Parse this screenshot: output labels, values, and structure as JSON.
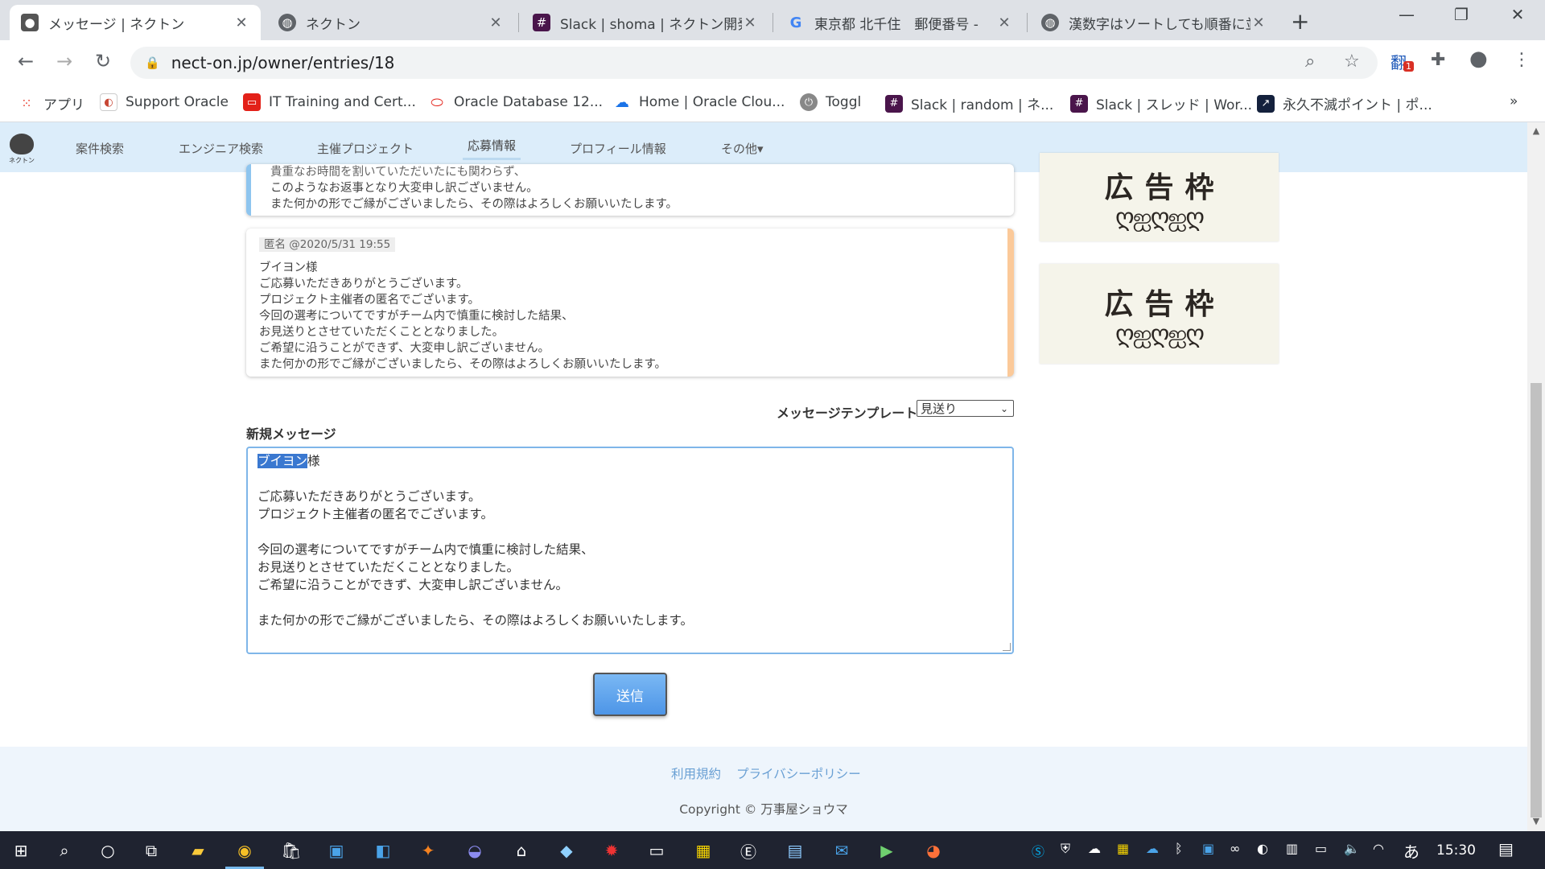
{
  "browser": {
    "tabs": [
      {
        "title": "メッセージ | ネクトン",
        "active": true
      },
      {
        "title": "ネクトン"
      },
      {
        "title": "Slack | shoma | ネクトン開発"
      },
      {
        "title": "東京都 北千住　郵便番号 -"
      },
      {
        "title": "漢数字はソートしても順番に並"
      }
    ],
    "url": "nect-on.jp/owner/entries/18",
    "extension_badge": "1",
    "bookmarks": [
      {
        "label": "アプリ"
      },
      {
        "label": "Support Oracle"
      },
      {
        "label": "IT Training and Cert..."
      },
      {
        "label": "Oracle Database 12..."
      },
      {
        "label": "Home | Oracle Clou..."
      },
      {
        "label": "Toggl"
      },
      {
        "label": "Slack | random | ネ..."
      },
      {
        "label": "Slack | スレッド | Wor..."
      },
      {
        "label": "永久不滅ポイント | ポ..."
      }
    ],
    "more_bookmarks": "»"
  },
  "site": {
    "logo_text": "ネクトン",
    "nav": [
      {
        "label": "案件検索"
      },
      {
        "label": "エンジニア検索"
      },
      {
        "label": "主催プロジェクト"
      },
      {
        "label": "応募情報",
        "active": true
      },
      {
        "label": "プロフィール情報"
      },
      {
        "label": "その他▾"
      }
    ]
  },
  "messages": {
    "own_partial_lines": [
      "貴重なお時間を割いていただいたにも関わらず、",
      "このようなお返事となり大変申し訳ございません。",
      "また何かの形でご縁がございましたら、その際はよろしくお願いいたします。"
    ],
    "other": {
      "meta": "匿名 @2020/5/31 19:55",
      "lines": [
        "ブイヨン様",
        "ご応募いただきありがとうございます。",
        "プロジェクト主催者の匿名でございます。",
        "今回の選考についてですがチーム内で慎重に検討した結果、",
        "お見送りとさせていただくこととなりました。",
        "ご希望に沿うことができず、大変申し訳ございません。",
        "また何かの形でご縁がございましたら、その際はよろしくお願いいたします。"
      ]
    }
  },
  "ads": [
    {
      "text": "広告枠",
      "ornament": "ღஐღஐღ"
    },
    {
      "text": "広告枠",
      "ornament": "ღஐღஐღ"
    }
  ],
  "form": {
    "template_label": "メッセージテンプレート",
    "template_selected": "見送り",
    "new_message_label": "新規メッセージ",
    "textarea_selected": "ブイヨン",
    "textarea_first_rest": "様",
    "textarea_lines": [
      "",
      "ご応募いただきありがとうございます。",
      "プロジェクト主催者の匿名でございます。",
      "",
      "今回の選考についてですがチーム内で慎重に検討した結果、",
      "お見送りとさせていただくこととなりました。",
      "ご希望に沿うことができず、大変申し訳ございません。",
      "",
      "また何かの形でご縁がございましたら、その際はよろしくお願いいたします。"
    ],
    "send_label": "送信"
  },
  "footer": {
    "terms": "利用規約",
    "privacy": "プライバシーポリシー",
    "copyright": "Copyright © 万事屋ショウマ"
  },
  "taskbar": {
    "ime": "あ",
    "time": "15:30"
  }
}
